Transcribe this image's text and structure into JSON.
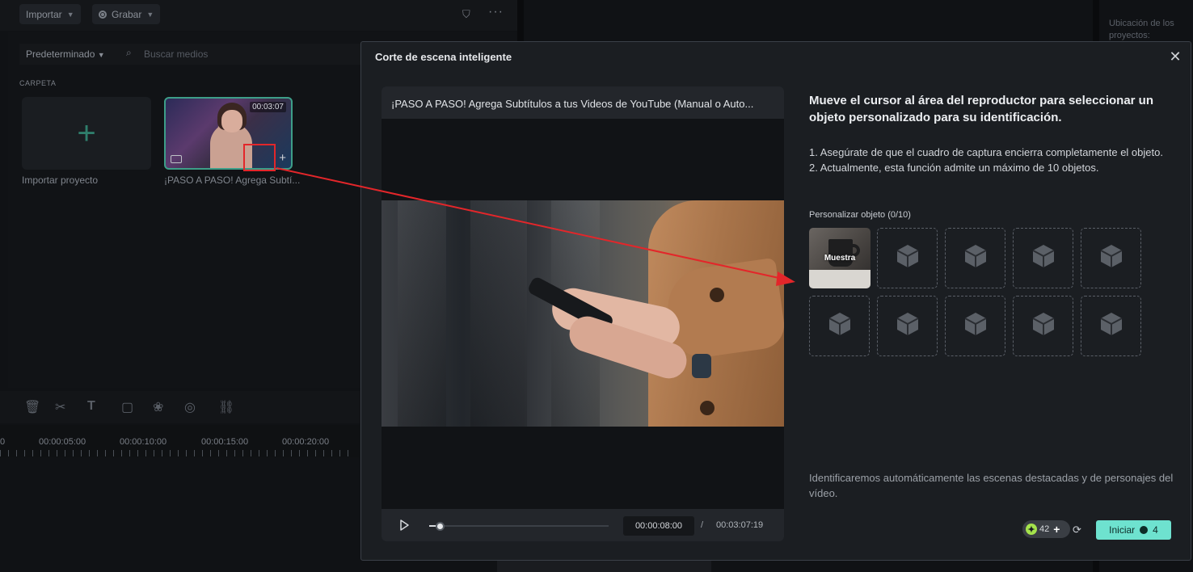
{
  "editor": {
    "import_label": "Importar",
    "record_label": "Grabar",
    "sort_label": "Predeterminado",
    "search_placeholder": "Buscar medios",
    "folder_label": "CARPETA",
    "import_project_label": "Importar proyecto",
    "video_caption": "¡PASO A PASO! Agrega Subtí...",
    "video_duration": "00:03:07",
    "ruler_labels": [
      "0",
      "00:00:05:00",
      "00:00:10:00",
      "00:00:15:00",
      "00:00:20:00"
    ],
    "right_panel_label": "Ubicación de los proyectos:"
  },
  "modal": {
    "title": "Corte de escena inteligente",
    "player": {
      "video_title": "¡PASO A PASO! Agrega Subtítulos a tus Videos de YouTube (Manual o Auto...",
      "current_time": "00:00:08:00",
      "separator": "/",
      "total_time": "00:03:07:19",
      "progress": 0.06
    },
    "heading": "Mueve el cursor al área del reproductor para seleccionar un objeto personalizado para su identificación.",
    "instruction_1": "1. Asegúrate de que el cuadro de captura encierra completamente el objeto.",
    "instruction_2": "2. Actualmente, esta función admite un máximo de 10 objetos.",
    "custom_object_label": "Personalizar objeto (0/10)",
    "sample_label": "Muestra",
    "footnote": "Identificaremos automáticamente las escenas destacadas y de personajes del vídeo.",
    "credits": "42",
    "start_label": "Iniciar",
    "start_cost": "4"
  },
  "colors": {
    "accent": "#6ee2cf",
    "annotation_red": "#e3262a",
    "credit_green": "#a5e34c"
  },
  "icons": [
    "chevron-down-icon",
    "record-icon",
    "filter-icon",
    "more-icon",
    "search-icon",
    "plus-icon",
    "close-icon",
    "play-icon",
    "cube-icon",
    "refresh-icon",
    "credit-icon"
  ]
}
